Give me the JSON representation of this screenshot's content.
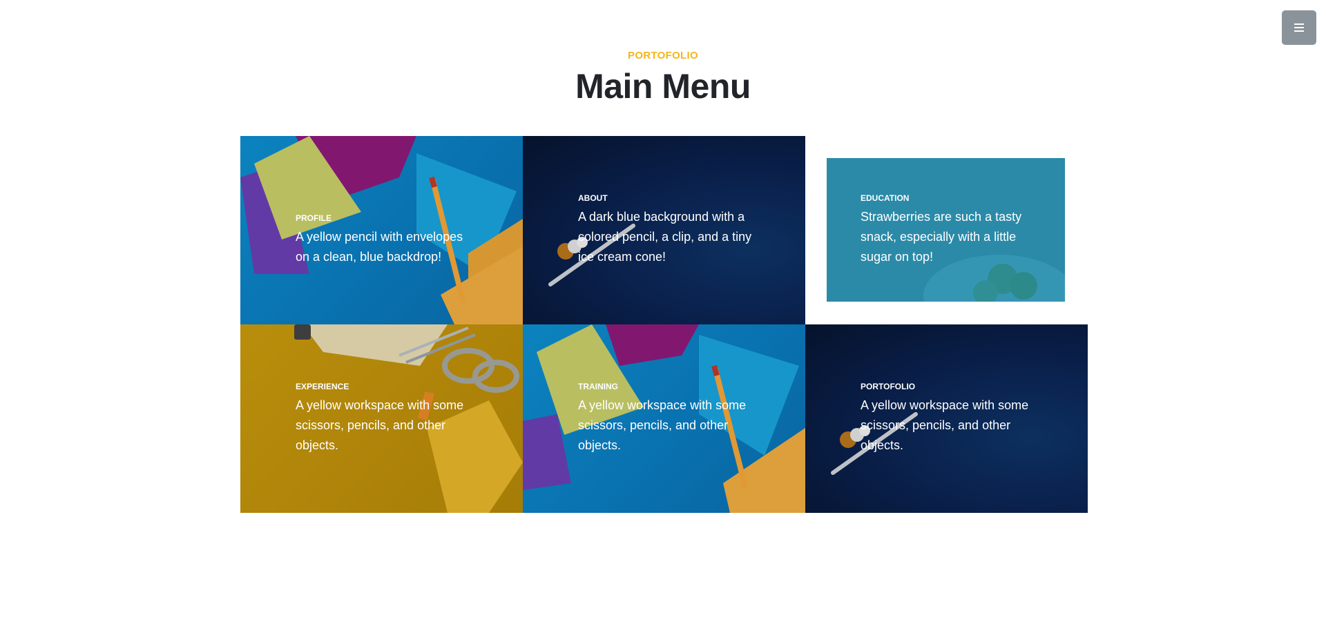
{
  "menu_toggle": {
    "icon": "hamburger-icon"
  },
  "header": {
    "subheading": "PORTOFOLIO",
    "title": "Main Menu"
  },
  "tiles": [
    {
      "title": "PROFILE",
      "text": "A yellow pencil with envelopes on a clean, blue backdrop!"
    },
    {
      "title": "ABOUT",
      "text": "A dark blue background with a colored pencil, a clip, and a tiny ice cream cone!"
    },
    {
      "title": "EDUCATION",
      "text": "Strawberries are such a tasty snack, especially with a little sugar on top!"
    },
    {
      "title": "EXPERIENCE",
      "text": "A yellow workspace with some scissors, pencils, and other objects."
    },
    {
      "title": "TRAINING",
      "text": "A yellow workspace with some scissors, pencils, and other objects."
    },
    {
      "title": "PORTOFOLIO",
      "text": "A yellow workspace with some scissors, pencils, and other objects."
    }
  ],
  "colors": {
    "accent": "#f4b619",
    "title": "#212529",
    "toggle": "#8a9399"
  }
}
